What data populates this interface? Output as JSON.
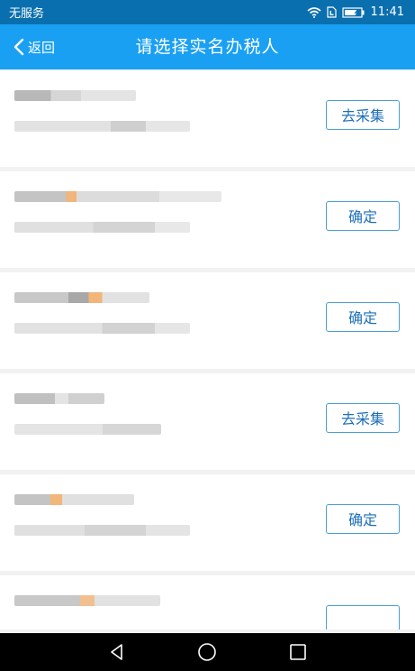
{
  "status_bar": {
    "carrier": "无服务",
    "time": "11:41"
  },
  "header": {
    "back_label": "返回",
    "title": "请选择实名办税人"
  },
  "taxpayers": [
    {
      "action": "去采集"
    },
    {
      "action": "确定"
    },
    {
      "action": "确定"
    },
    {
      "action": "去采集"
    },
    {
      "action": "确定"
    },
    {
      "action": ""
    }
  ],
  "colors": {
    "status_bar_bg": "#0a6fae",
    "nav_bg": "#1aa0f2",
    "button_border": "#4a9fd8",
    "button_text": "#1e6fb8",
    "page_bg": "#f2f2f2"
  },
  "icons": {
    "status": [
      "wifi-icon",
      "sim-icon",
      "battery-icon"
    ],
    "navigation": [
      "back-triangle-icon",
      "home-circle-icon",
      "recents-square-icon"
    ]
  }
}
